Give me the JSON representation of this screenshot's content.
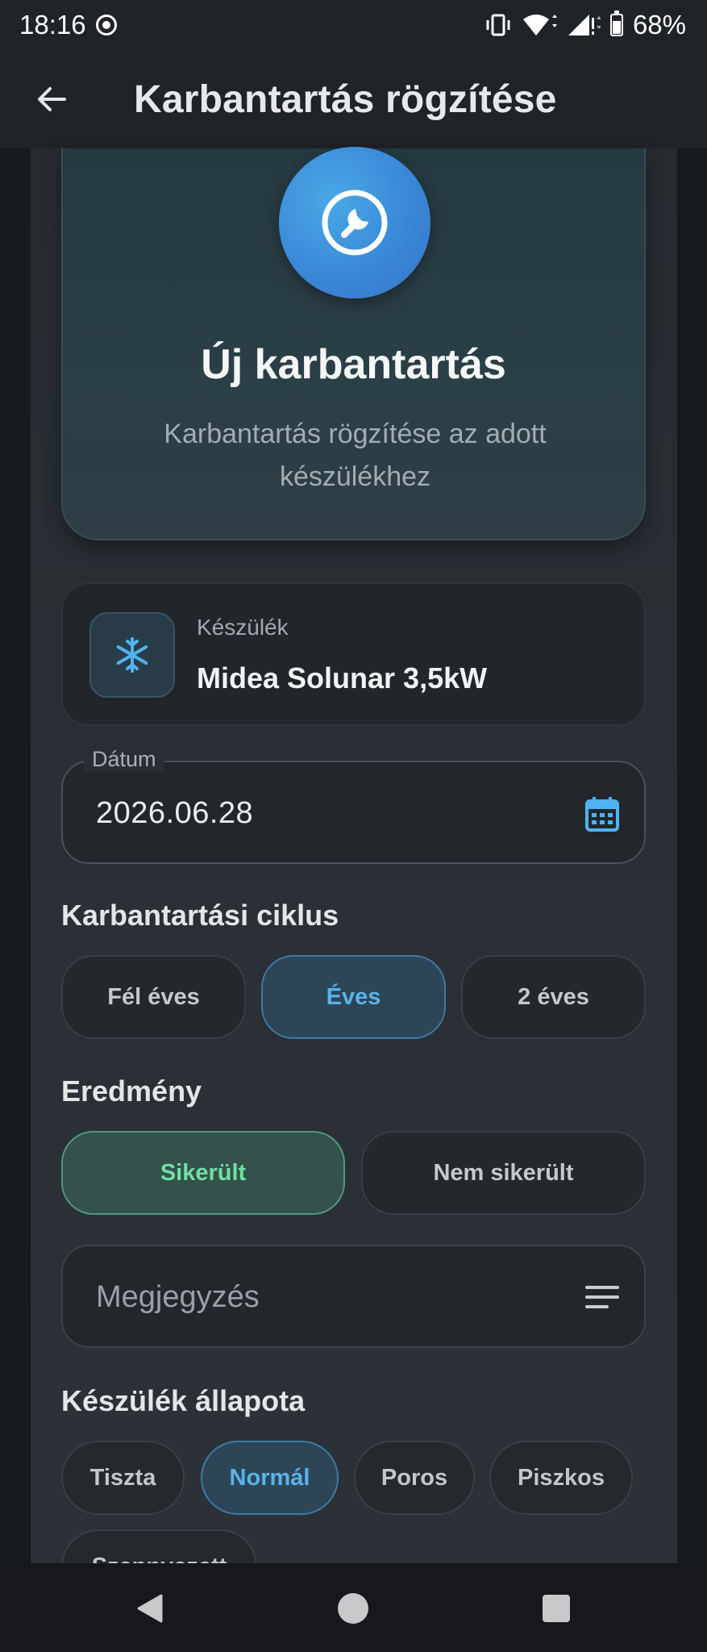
{
  "status_bar": {
    "time": "18:16",
    "battery": "68%"
  },
  "app_bar": {
    "title": "Karbantartás rögzítése"
  },
  "hero": {
    "title": "Új karbantartás",
    "subtitle": "Karbantartás rögzítése az adott készülékhez",
    "icon": "wrench-icon"
  },
  "device": {
    "label": "Készülék",
    "name": "Midea Solunar 3,5kW",
    "icon": "snowflake-icon"
  },
  "date": {
    "label": "Dátum",
    "value": "2026.06.28"
  },
  "cycle": {
    "title": "Karbantartási ciklus",
    "options": [
      "Fél éves",
      "Éves",
      "2 éves"
    ],
    "selected": "Éves"
  },
  "result": {
    "title": "Eredmény",
    "options": [
      "Sikerült",
      "Nem sikerült"
    ],
    "selected": "Sikerült"
  },
  "note": {
    "placeholder": "Megjegyzés"
  },
  "condition": {
    "title": "Készülék állapota",
    "options": [
      "Tiszta",
      "Normál",
      "Poros",
      "Piszkos",
      "Szennyezett"
    ],
    "selected": "Normál"
  },
  "colors": {
    "accent_blue": "#5ab3ea",
    "accent_green": "#6fe0a4",
    "background": "#16191d"
  }
}
